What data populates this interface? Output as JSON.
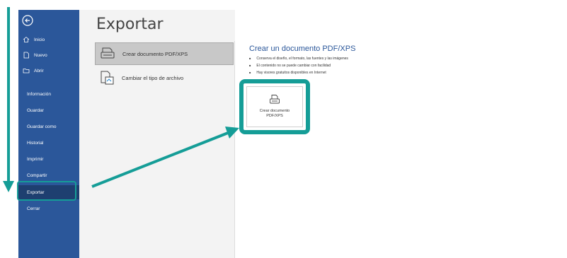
{
  "sidebar": {
    "back_icon": "back-arrow-icon",
    "items": [
      {
        "label": "Inicio",
        "icon": "home-icon"
      },
      {
        "label": "Nuevo",
        "icon": "new-document-icon"
      },
      {
        "label": "Abrir",
        "icon": "open-folder-icon"
      },
      {
        "label": "Información"
      },
      {
        "label": "Guardar"
      },
      {
        "label": "Guardar como"
      },
      {
        "label": "Historial"
      },
      {
        "label": "Imprimir"
      },
      {
        "label": "Compartir"
      },
      {
        "label": "Exportar"
      },
      {
        "label": "Cerrar"
      }
    ],
    "active": "Exportar"
  },
  "main": {
    "title": "Exportar",
    "options": [
      {
        "label": "Crear documento PDF/XPS",
        "icon": "pdf-document-icon",
        "selected": true
      },
      {
        "label": "Cambiar el tipo de archivo",
        "icon": "change-file-type-icon",
        "selected": false
      }
    ]
  },
  "right_pane": {
    "title": "Crear un documento PDF/XPS",
    "bullets": [
      "Conserva el diseño, el formato, las fuentes y las imágenes",
      "El contenido no se puede cambiar con facilidad",
      "Hay visores gratuitos disponibles en Internet"
    ],
    "button": {
      "label": "Crear documento PDF/XPS",
      "icon": "pdf-document-icon"
    }
  },
  "colors": {
    "sidebar_bg": "#2b579a",
    "sidebar_active": "#1e3f70",
    "annotation_teal": "#159d97",
    "right_title": "#2b579a"
  },
  "annotations": {
    "vertical_arrow": "arrow-down-icon",
    "diagonal_arrow": "arrow-icon",
    "highlights": [
      "exportar-item",
      "create-pdf-button"
    ]
  }
}
